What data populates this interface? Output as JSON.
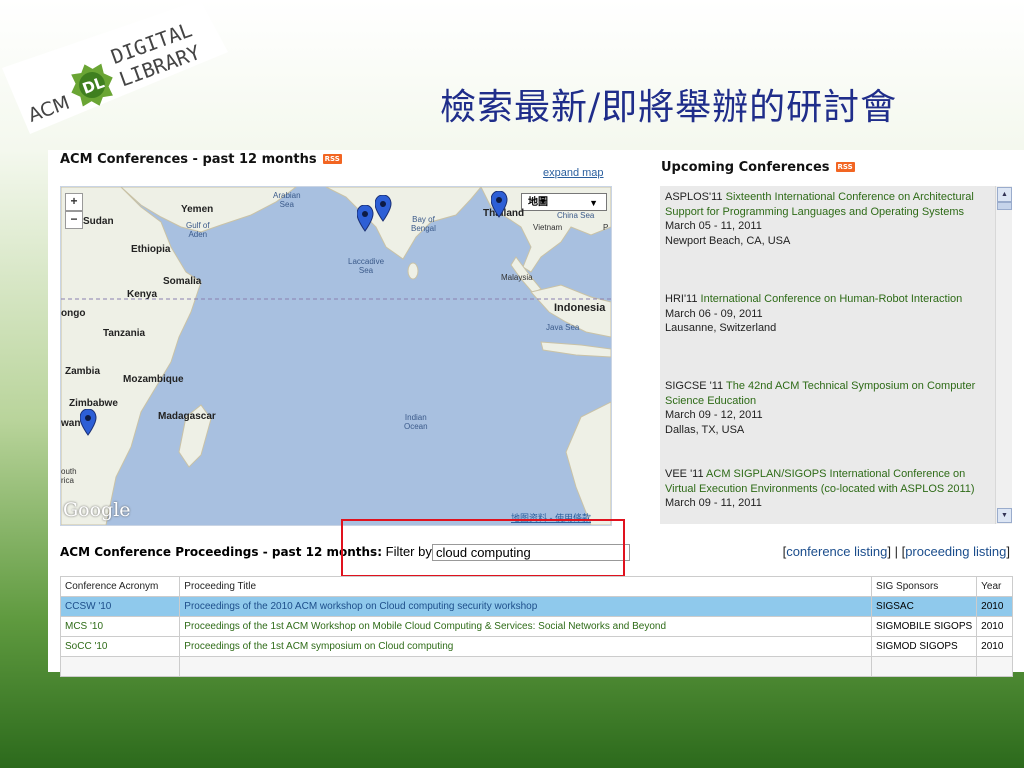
{
  "logo": {
    "acm": "ACM",
    "dl": "DL",
    "line1": "DIGITAL",
    "line2": "LIBRARY"
  },
  "slide_title": "檢索最新/即將舉辦的研討會",
  "conferences": {
    "title": "ACM Conferences - past 12 months",
    "rss": "RSS",
    "expand_map": "expand map"
  },
  "map": {
    "zoom_in": "+",
    "zoom_out": "−",
    "type_label": "地圖",
    "type_arrow": "▼",
    "google": "Google",
    "footer": "地图资料 - 使用條款",
    "labels": {
      "arabian": "Arabian\nSea",
      "yemen": "Yemen",
      "gulf": "Gulf of\nAden",
      "sudan": "Sudan",
      "ethiopia": "Ethiopia",
      "bay": "Bay of\nBengal",
      "china_sea": "China Sea",
      "thailand": "Thailand",
      "vietnam": "Vietnam",
      "p": "P",
      "laccadive": "Laccadive\nSea",
      "somalia": "Somalia",
      "kenya": "Kenya",
      "malaysia": "Malaysia",
      "ongo": "ongo",
      "indonesia": "Indonesia",
      "java": "Java Sea",
      "tanzania": "Tanzania",
      "zambia": "Zambia",
      "mozambique": "Mozambique",
      "zimbabwe": "Zimbabwe",
      "madagascar": "Madagascar",
      "indian": "Indian\nOcean",
      "wan": "wan",
      "south": "outh\nrica"
    }
  },
  "upcoming": {
    "title": "Upcoming Conferences",
    "rss": "RSS",
    "items": [
      {
        "acronym": "ASPLOS'11",
        "title": "Sixteenth International Conference on Architectural Support for Programming Languages and Operating Systems",
        "dates": "March 05 - 11, 2011",
        "location": "Newport Beach, CA, USA"
      },
      {
        "acronym": "HRI'11",
        "title": "International Conference on Human-Robot Interaction",
        "dates": "March 06 - 09, 2011",
        "location": "Lausanne, Switzerland"
      },
      {
        "acronym": "SIGCSE '11",
        "title": "The 42nd ACM Technical Symposium on Computer Science Education",
        "dates": "March 09 - 12, 2011",
        "location": "Dallas, TX, USA"
      },
      {
        "acronym": "VEE '11",
        "title": "ACM SIGPLAN/SIGOPS International Conference on Virtual Execution Environments (co-located with ASPLOS 2011)",
        "dates": "March 09 - 11, 2011",
        "location": ""
      }
    ]
  },
  "proceedings": {
    "title": "ACM Conference Proceedings - past 12 months:",
    "filter_label": "Filter by",
    "filter_value": "cloud computing",
    "listing_open": "[",
    "conference_listing": "conference listing",
    "listing_sep": "] | [",
    "proceeding_listing": "proceeding listing",
    "listing_close": "]",
    "columns": [
      "Conference Acronym",
      "Proceeding Title",
      "SIG Sponsors",
      "Year"
    ],
    "rows": [
      {
        "acronym": "CCSW '10",
        "title": "Proceedings of the 2010 ACM workshop on Cloud computing security workshop",
        "sponsors": "SIGSAC",
        "year": "2010",
        "selected": true
      },
      {
        "acronym": "MCS '10",
        "title": "Proceedings of the 1st ACM Workshop on Mobile Cloud Computing & Services: Social Networks and Beyond",
        "sponsors": "SIGMOBILE SIGOPS",
        "year": "2010",
        "selected": false
      },
      {
        "acronym": "SoCC '10",
        "title": "Proceedings of the 1st ACM symposium on Cloud computing",
        "sponsors": "SIGMOD SIGOPS",
        "year": "2010",
        "selected": false
      }
    ]
  },
  "colors": {
    "highlight_box": "#e0121e",
    "selected_row": "#8fc9ec",
    "link_green": "#2e6b17",
    "title_blue": "#1f2d8a"
  }
}
